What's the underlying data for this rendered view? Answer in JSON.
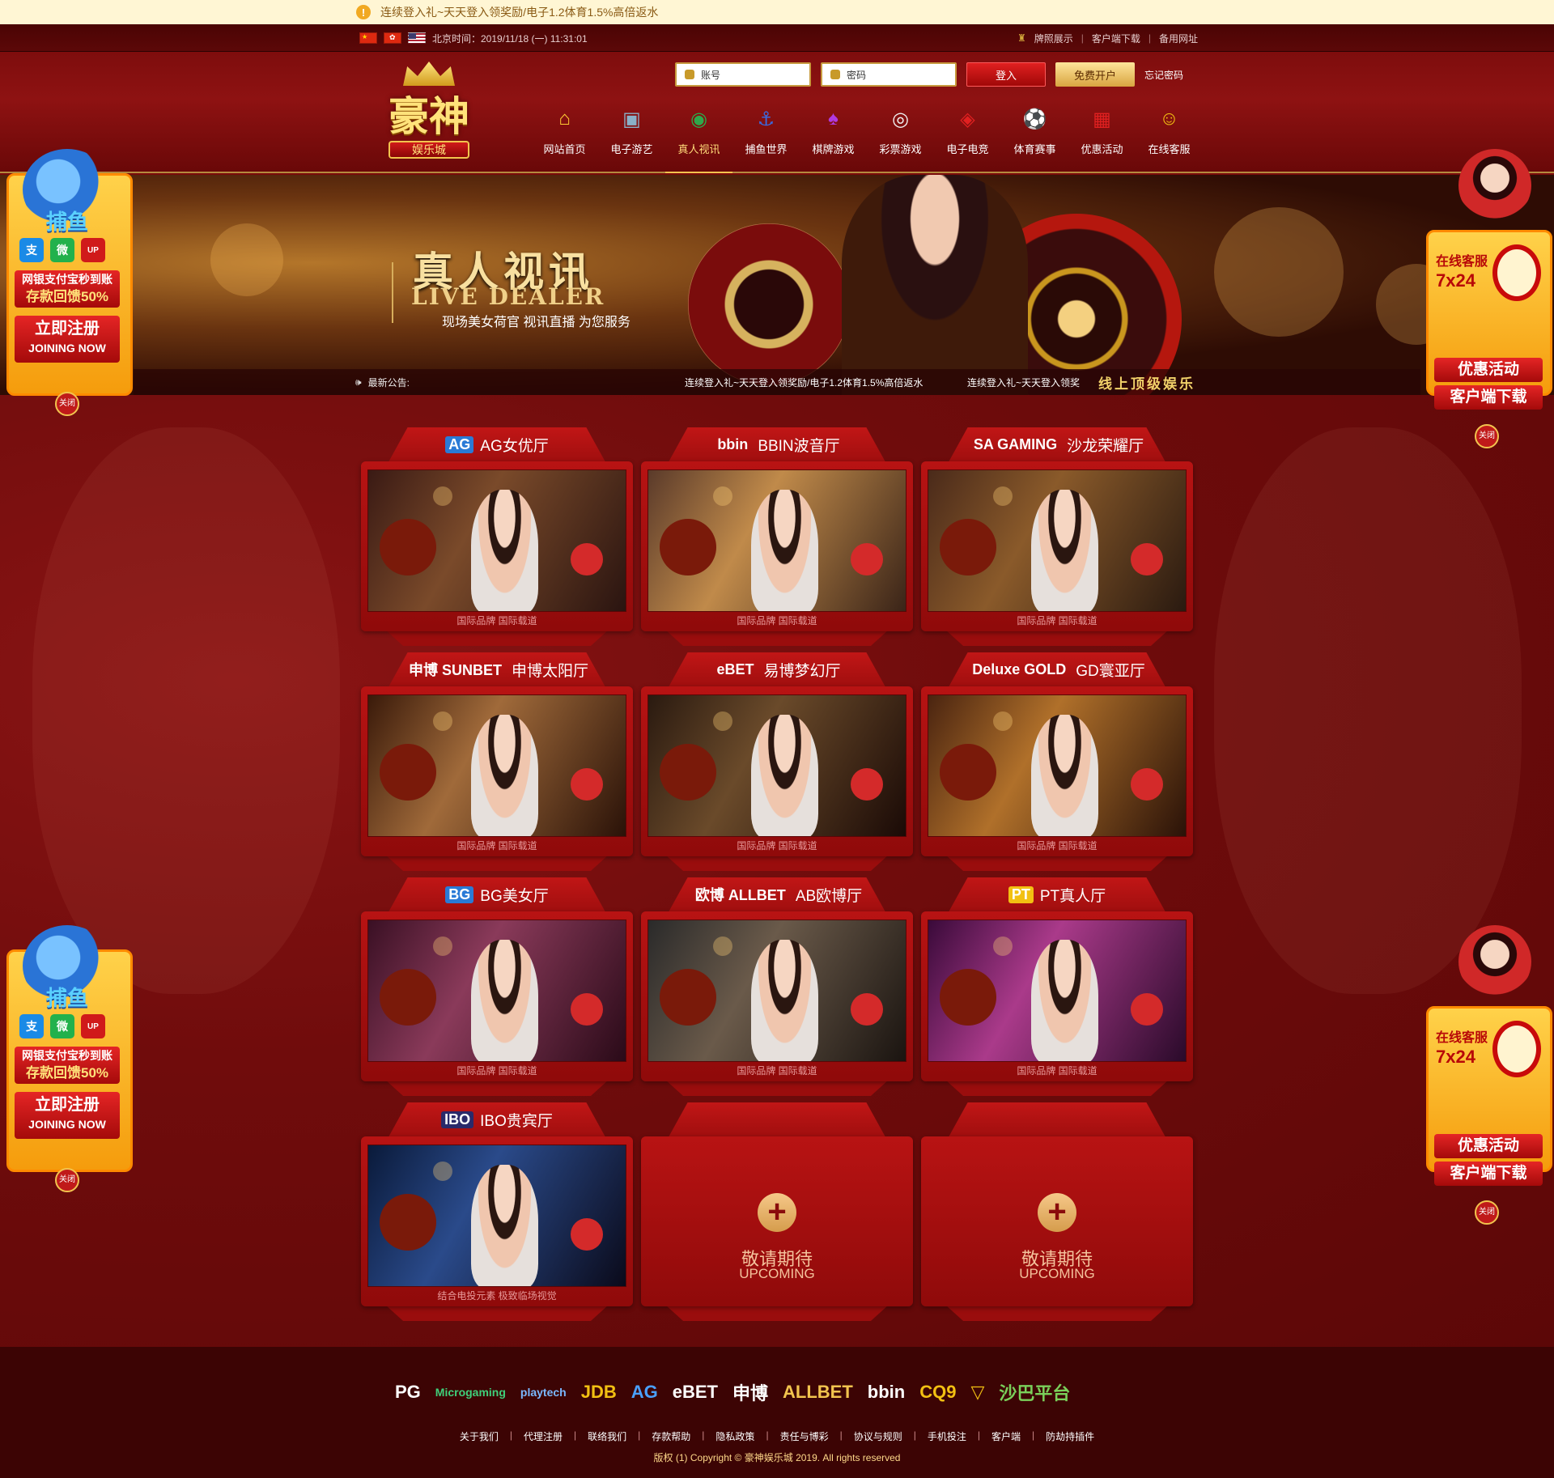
{
  "notice": {
    "text": "连续登入礼~天天登入领奖励/电子1.2体育1.5%高倍返水"
  },
  "topbar": {
    "datetime": "北京时间：2019/11/18 (一) 11:31:01",
    "links": [
      "牌照展示",
      "客户端下载",
      "备用网址"
    ]
  },
  "logo": {
    "title": "豪神",
    "subtitle": "娱乐城"
  },
  "login": {
    "account_placeholder": "账号",
    "password_placeholder": "密码",
    "login_label": "登入",
    "register_label": "免费开户",
    "forgot_label": "忘记密码"
  },
  "nav": [
    {
      "label": "网站首页",
      "icon": "home-icon",
      "glyph": "⌂"
    },
    {
      "label": "电子游艺",
      "icon": "slot-machine-icon",
      "glyph": "▣"
    },
    {
      "label": "真人视讯",
      "icon": "chip-icon",
      "glyph": "◉"
    },
    {
      "label": "捕鱼世界",
      "icon": "anchor-icon",
      "glyph": "⚓"
    },
    {
      "label": "棋牌游戏",
      "icon": "cards-icon",
      "glyph": "♠"
    },
    {
      "label": "彩票游戏",
      "icon": "lottery-ball-icon",
      "glyph": "◎"
    },
    {
      "label": "电子电竞",
      "icon": "mouse-icon",
      "glyph": "◈"
    },
    {
      "label": "体育赛事",
      "icon": "soccer-ball-icon",
      "glyph": "⚽"
    },
    {
      "label": "优惠活动",
      "icon": "gift-icon",
      "glyph": "▦"
    },
    {
      "label": "在线客服",
      "icon": "support-agent-icon",
      "glyph": "☺"
    }
  ],
  "nav_active": 2,
  "banner": {
    "title_cn": "真人视讯",
    "title_en": "LIVE DEALER",
    "subtitle": "现场美女荷官 视讯直播 为您服务"
  },
  "ticker": {
    "label": "最新公告:",
    "message1": "连续登入礼~天天登入领奖励/电子1.2体育1.5%高倍返水",
    "message2": "连续登入礼~天天登入领奖",
    "slogan": "线上顶级娱乐"
  },
  "halls": [
    {
      "brand": "AG",
      "name": "AG女优厅",
      "caption": "国际品牌  国际载道",
      "brand_color": "#2a7ad6"
    },
    {
      "brand": "bbin",
      "name": "BBIN波音厅",
      "caption": "国际品牌  国际载道",
      "brand_color": ""
    },
    {
      "brand": "SA GAMING",
      "name": "沙龙荣耀厅",
      "caption": "国际品牌  国际载道",
      "brand_color": ""
    },
    {
      "brand": "申博 SUNBET",
      "name": "申博太阳厅",
      "caption": "国际品牌  国际载道",
      "brand_color": ""
    },
    {
      "brand": "eBET",
      "name": "易博梦幻厅",
      "caption": "国际品牌  国际载道",
      "brand_color": ""
    },
    {
      "brand": "Deluxe GOLD",
      "name": "GD寰亚厅",
      "caption": "国际品牌  国际载道",
      "brand_color": ""
    },
    {
      "brand": "BG",
      "name": "BG美女厅",
      "caption": "国际品牌  国际载道",
      "brand_color": "#2a7ad6"
    },
    {
      "brand": "欧博 ALLBET",
      "name": "AB欧博厅",
      "caption": "国际品牌  国际载道",
      "brand_color": ""
    },
    {
      "brand": "PT",
      "name": "PT真人厅",
      "caption": "国际品牌  国际载道",
      "brand_color": "#f2c012"
    },
    {
      "brand": "IBO",
      "name": "IBO贵宾厅",
      "caption": "结合电投元素  极致临场视觉",
      "brand_color": "#2a2a6a"
    }
  ],
  "upcoming": {
    "cn": "敬请期待",
    "en": "UPCOMING"
  },
  "side_left": {
    "game": "捕鱼",
    "pay_icons": [
      "支",
      "微",
      "UP"
    ],
    "promo_line1": "网银支付宝秒到账",
    "promo_line2": "存款回馈50%",
    "register_cn": "立即注册",
    "register_en": "JOINING NOW",
    "close": "关闭"
  },
  "side_right": {
    "cs_line1": "在线客服",
    "cs_line2": "7x24",
    "promo": "优惠活动",
    "download": "客户端下载",
    "close": "关闭"
  },
  "partners": [
    "PG",
    "Microgaming",
    "playtech",
    "JDB",
    "AG",
    "eBET",
    "申博",
    "ALLBET",
    "bbin",
    "CQ9",
    "▽",
    "沙巴平台"
  ],
  "footer": {
    "links": [
      "关于我们",
      "代理注册",
      "联络我们",
      "存款帮助",
      "隐私政策",
      "责任与博彩",
      "协议与规则",
      "手机投注",
      "客户端",
      "防劫持插件"
    ],
    "copyright": "版权 (1) Copyright © 豪神娱乐城 2019. All rights reserved"
  },
  "colors": {
    "primary_red": "#8e1212",
    "gold": "#f2c44e",
    "dark_red": "#3c0404"
  }
}
